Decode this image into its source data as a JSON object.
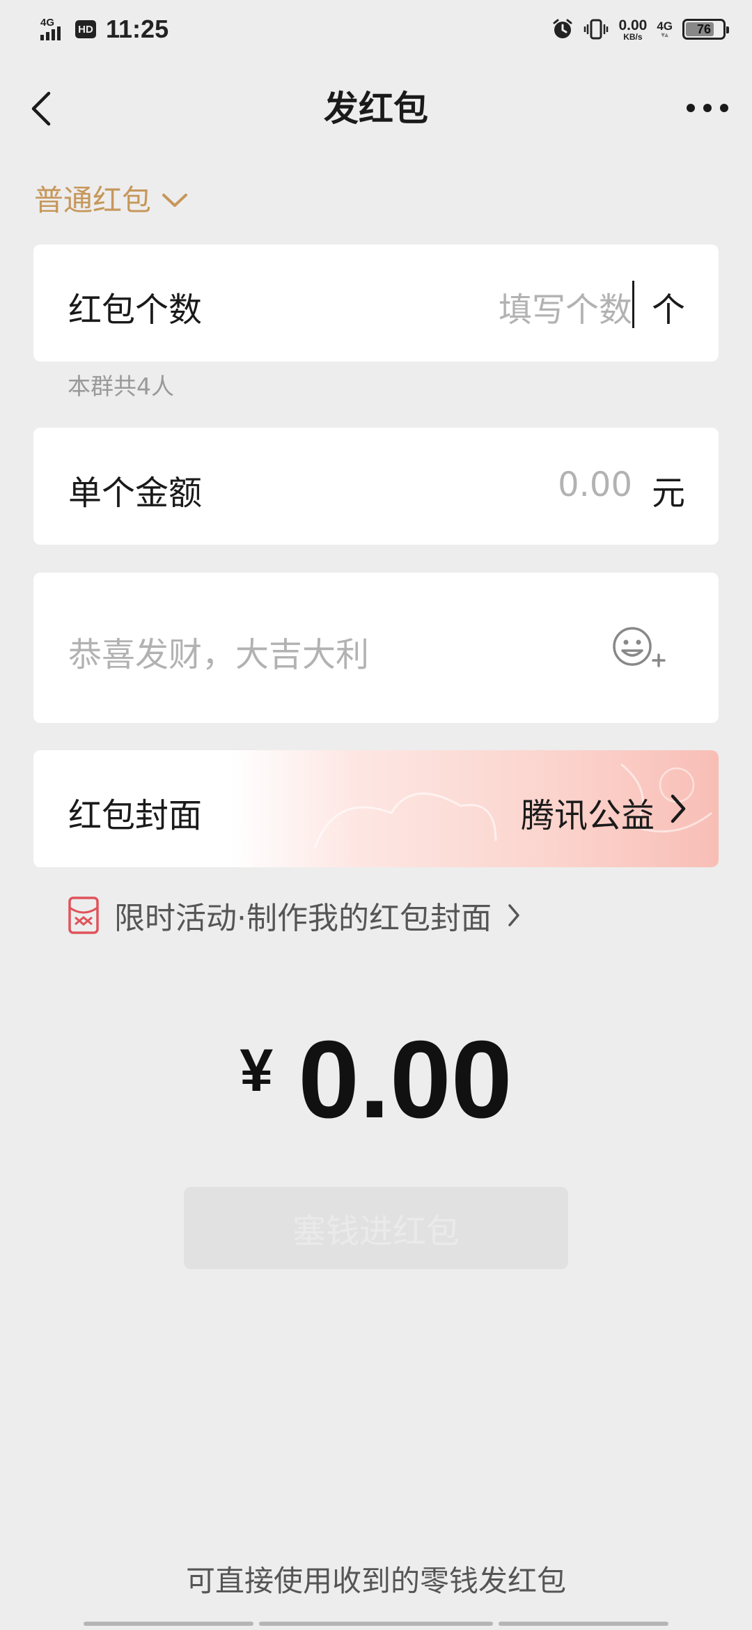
{
  "status_bar": {
    "network_left": "4G",
    "hd_label": "HD",
    "time": "11:25",
    "net_speed_value": "0.00",
    "net_speed_unit": "KB/s",
    "network_right": "4G",
    "battery": "76",
    "battery_level": 0.76
  },
  "nav": {
    "title": "发红包"
  },
  "packet_type": {
    "label": "普通红包"
  },
  "count_row": {
    "label": "红包个数",
    "placeholder": "填写个数",
    "unit": "个",
    "hint": "本群共4人"
  },
  "amount_row": {
    "label": "单个金额",
    "placeholder": "0.00",
    "unit": "元"
  },
  "greeting": {
    "placeholder": "恭喜发财，大吉大利"
  },
  "cover_row": {
    "label": "红包封面",
    "value": "腾讯公益"
  },
  "promo": {
    "text": "限时活动·制作我的红包封面"
  },
  "total": {
    "currency": "¥",
    "value": "0.00"
  },
  "submit": {
    "label": "塞钱进红包"
  },
  "footer": {
    "note": "可直接使用收到的零钱发红包"
  },
  "colors": {
    "accent_gold": "#c6975a",
    "background": "#ededed",
    "card": "#ffffff",
    "placeholder": "#b2b2b2",
    "cover_pink": "#f8beb6",
    "promo_red": "#e0535a"
  }
}
